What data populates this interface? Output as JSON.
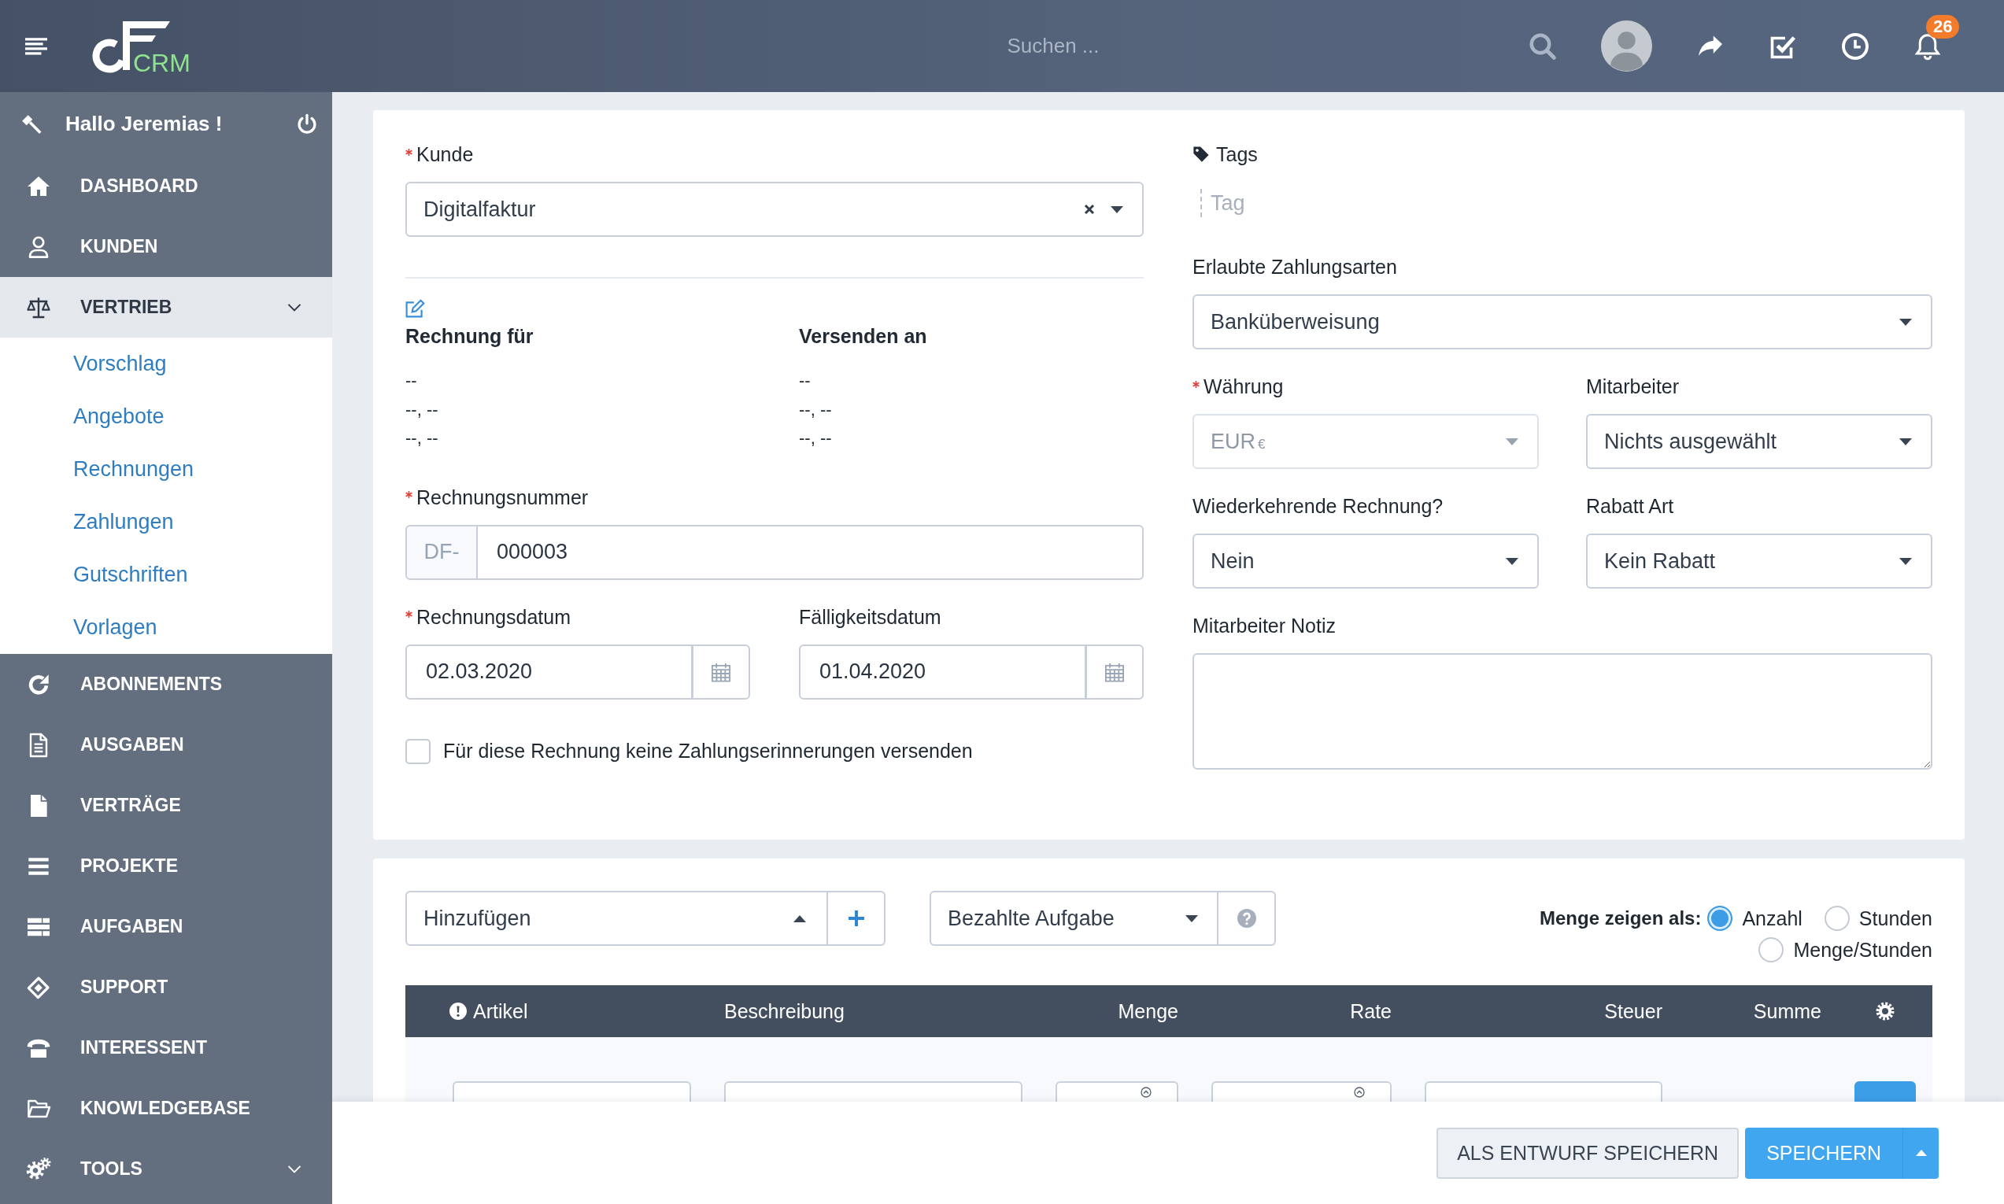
{
  "topbar": {
    "brand": "CRM",
    "search": {
      "placeholder": "Suchen ..."
    },
    "notifications": {
      "count": "26"
    }
  },
  "sidebar": {
    "greeting": "Hallo Jeremias !",
    "items": [
      {
        "label": "DASHBOARD",
        "kind": "link",
        "expanded": false
      },
      {
        "label": "KUNDEN",
        "kind": "link",
        "expanded": false
      },
      {
        "label": "VERTRIEB",
        "kind": "group",
        "expanded": true,
        "children": [
          {
            "label": "Vorschlag",
            "selected": false
          },
          {
            "label": "Angebote",
            "selected": false
          },
          {
            "label": "Rechnungen",
            "selected": false
          },
          {
            "label": "Zahlungen",
            "selected": false
          },
          {
            "label": "Gutschriften",
            "selected": false
          },
          {
            "label": "Vorlagen",
            "selected": false
          }
        ]
      },
      {
        "label": "ABONNEMENTS",
        "kind": "link",
        "expanded": false
      },
      {
        "label": "AUSGABEN",
        "kind": "link",
        "expanded": false
      },
      {
        "label": "VERTRÄGE",
        "kind": "link",
        "expanded": false
      },
      {
        "label": "PROJEKTE",
        "kind": "link",
        "expanded": false
      },
      {
        "label": "AUFGABEN",
        "kind": "link",
        "expanded": false
      },
      {
        "label": "SUPPORT",
        "kind": "link",
        "expanded": false
      },
      {
        "label": "INTERESSENT",
        "kind": "link",
        "expanded": false
      },
      {
        "label": "KNOWLEDGEBASE",
        "kind": "link",
        "expanded": false
      },
      {
        "label": "TOOLS",
        "kind": "group",
        "expanded": false
      }
    ]
  },
  "invoice_form": {
    "customer": {
      "label": "Kunde",
      "required": true,
      "value": "Digitalfaktur"
    },
    "addresses": [
      {
        "title": "Rechnung für",
        "lines": [
          "--",
          "--, --",
          "--, --"
        ]
      },
      {
        "title": "Versenden an",
        "lines": [
          "--",
          "--, --",
          "--, --"
        ]
      }
    ],
    "invoice_number": {
      "label": "Rechnungsnummer",
      "required": true,
      "prefix": "DF-",
      "value": "000003"
    },
    "dates": [
      {
        "label": "Rechnungsdatum",
        "required": true,
        "value": "02.03.2020"
      },
      {
        "label": "Fälligkeitsdatum",
        "required": false,
        "value": "01.04.2020"
      }
    ],
    "no_reminders": {
      "label": "Für diese Rechnung keine Zahlungserinnerungen versenden",
      "checked": false
    },
    "tags": {
      "label": "Tags",
      "placeholder": "Tag"
    },
    "payment_modes": {
      "label": "Erlaubte Zahlungsarten",
      "required": false,
      "value": "Banküberweisung"
    },
    "selects": [
      {
        "label": "Währung",
        "required": true,
        "value": "EUR",
        "suffix": "€",
        "disabled": true
      },
      {
        "label": "Mitarbeiter",
        "required": false,
        "value": "Nichts ausgewählt",
        "disabled": false
      },
      {
        "label": "Wiederkehrende Rechnung?",
        "required": false,
        "value": "Nein",
        "disabled": false
      },
      {
        "label": "Rabatt Art",
        "required": false,
        "value": "Kein Rabatt",
        "disabled": false
      }
    ],
    "staff_note": {
      "label": "Mitarbeiter Notiz",
      "required": false
    }
  },
  "items_section": {
    "add_select": {
      "value": "Hinzufügen"
    },
    "task_select": {
      "value": "Bezahlte Aufgabe"
    },
    "quantity_mode": {
      "label": "Menge zeigen als:",
      "options": [
        {
          "label": "Anzahl",
          "selected": true
        },
        {
          "label": "Stunden",
          "selected": false
        },
        {
          "label": "Menge/Stunden",
          "selected": false
        }
      ]
    },
    "table": {
      "columns": [
        {
          "label": "Artikel"
        },
        {
          "label": "Beschreibung"
        },
        {
          "label": "Menge"
        },
        {
          "label": "Rate"
        },
        {
          "label": "Steuer"
        },
        {
          "label": "Summe"
        }
      ]
    }
  },
  "footer": {
    "buttons": [
      {
        "label": "ALS ENTWURF SPEICHERN",
        "kind": "secondary"
      },
      {
        "label": "SPEICHERN",
        "kind": "primary"
      }
    ]
  }
}
